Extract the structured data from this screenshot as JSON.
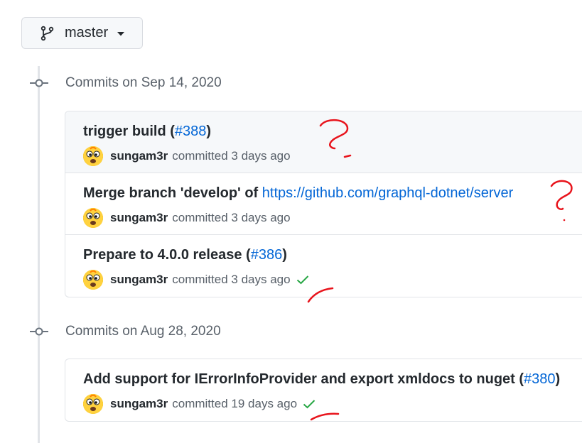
{
  "branch": {
    "label": "master"
  },
  "groups": [
    {
      "date_label": "Commits on Sep 14, 2020",
      "commits": [
        {
          "title": "trigger build",
          "pr_prefix": " (",
          "link": "#388",
          "pr_suffix": ")",
          "author": "sungam3r",
          "action": "committed",
          "time": "3 days ago",
          "status": "none"
        },
        {
          "title": "Merge branch 'develop' of ",
          "link": "https://github.com/graphql-dotnet/server",
          "author": "sungam3r",
          "action": "committed",
          "time": "3 days ago",
          "status": "none"
        },
        {
          "title": "Prepare to 4.0.0 release",
          "pr_prefix": " (",
          "link": "#386",
          "pr_suffix": ")",
          "author": "sungam3r",
          "action": "committed",
          "time": "3 days ago",
          "status": "success"
        }
      ]
    },
    {
      "date_label": "Commits on Aug 28, 2020",
      "commits": [
        {
          "title": "Add support for IErrorInfoProvider and export xmldocs to nuget",
          "pr_prefix": " (",
          "link": "#380",
          "pr_suffix": ")",
          "author": "sungam3r",
          "action": "committed",
          "time": "19 days ago",
          "status": "success"
        }
      ]
    }
  ],
  "icons": {
    "branch": "git-branch-icon",
    "caret": "caret-down-icon",
    "commit": "git-commit-icon",
    "check": "check-icon",
    "avatar": "avatar"
  },
  "colors": {
    "link": "#0366d6",
    "success": "#28a745",
    "annotation": "#e8141c"
  }
}
